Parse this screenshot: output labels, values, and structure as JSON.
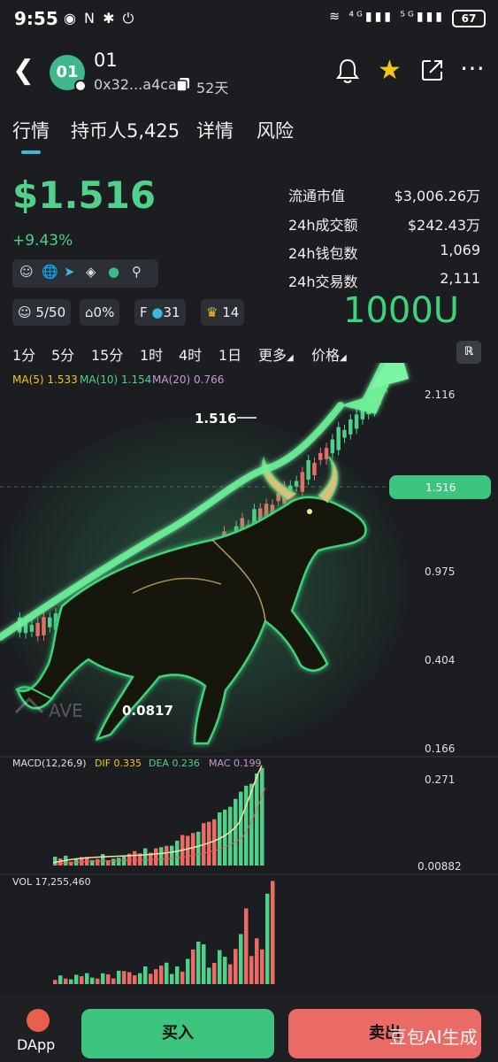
{
  "status_bar": {
    "time": "9:55",
    "left_icons": "◉ N ✱ ⏻",
    "right_icons": "≋ ⁴ᴳ▮▮▮ ⁵ᴳ▮▮▮",
    "battery": "67"
  },
  "header": {
    "token_logo_text": "01",
    "token_name": "01",
    "address": "0x32...a4ca",
    "age": "52天",
    "icons": [
      "back-icon",
      "bell-icon",
      "star-icon",
      "share-icon",
      "more-icon"
    ]
  },
  "tabs": [
    {
      "label": "行情",
      "active": true
    },
    {
      "label": "持币人5,425",
      "active": false
    },
    {
      "label": "详情",
      "active": false
    },
    {
      "label": "风险",
      "active": false
    }
  ],
  "price": {
    "value": "$1.516",
    "change": "+9.43%"
  },
  "stats": [
    {
      "label": "流通市值",
      "value": "$3,006.26万"
    },
    {
      "label": "24h成交额",
      "value": "$242.43万"
    },
    {
      "label": "24h钱包数",
      "value": "1,069"
    },
    {
      "label": "24h交易数",
      "value": "2,111"
    }
  ],
  "social_icons": [
    "user-icon",
    "globe-icon",
    "telegram-icon",
    "twitter-icon",
    "token-icon",
    "search-icon"
  ],
  "chips": {
    "holders": "5/50",
    "house": "0%",
    "f_label": "F",
    "f_value": "31",
    "trophy": "14"
  },
  "overlay_text": "1000U",
  "timeframes": [
    "1分",
    "5分",
    "15分",
    "1时",
    "4时",
    "1日",
    "更多",
    "价格"
  ],
  "timeframe_button": "ℝ",
  "ma": {
    "ma5": "MA(5) 1.533",
    "ma10": "MA(10) 1.154",
    "ma20": "MA(20) 0.766"
  },
  "chart_labels": {
    "high_marker": "1.516",
    "low_marker": "0.0817",
    "axis": [
      "2.116",
      "0.975",
      "0.404",
      "0.166"
    ],
    "current": "1.516",
    "macd_title": "MACD(12,26,9)",
    "dif": "DIF 0.335",
    "dea": "DEA 0.236",
    "macd": "MAC 0.199",
    "macd_axis": [
      "0.271",
      "0.00882"
    ],
    "vol_title": "VOL 17,255,460",
    "watermark_logo": "AVE"
  },
  "colors": {
    "up": "#4fd08b",
    "down": "#ea6a65",
    "accent": "#3fb8d8"
  },
  "bottom": {
    "dapp_label": "DApp",
    "buy_label": "买入",
    "sell_label": "卖出",
    "watermark": "豆包AI生成"
  }
}
